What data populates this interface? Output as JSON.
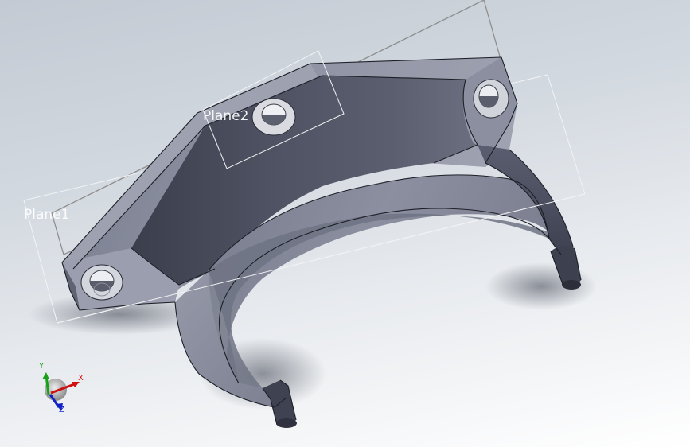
{
  "viewport": {
    "planes": [
      {
        "name": "Plane1"
      },
      {
        "name": "Plane2"
      }
    ],
    "triad": {
      "x_label": "X",
      "y_label": "Y",
      "z_label": "Z"
    },
    "colors": {
      "part_face": "#6e7283",
      "part_edge": "#1d1f27",
      "plane_outline": "#f2f3f5",
      "sketch_line": "#8e8e8e",
      "axis_x": "#d01010",
      "axis_y": "#18a018",
      "axis_z": "#1020c8"
    }
  }
}
